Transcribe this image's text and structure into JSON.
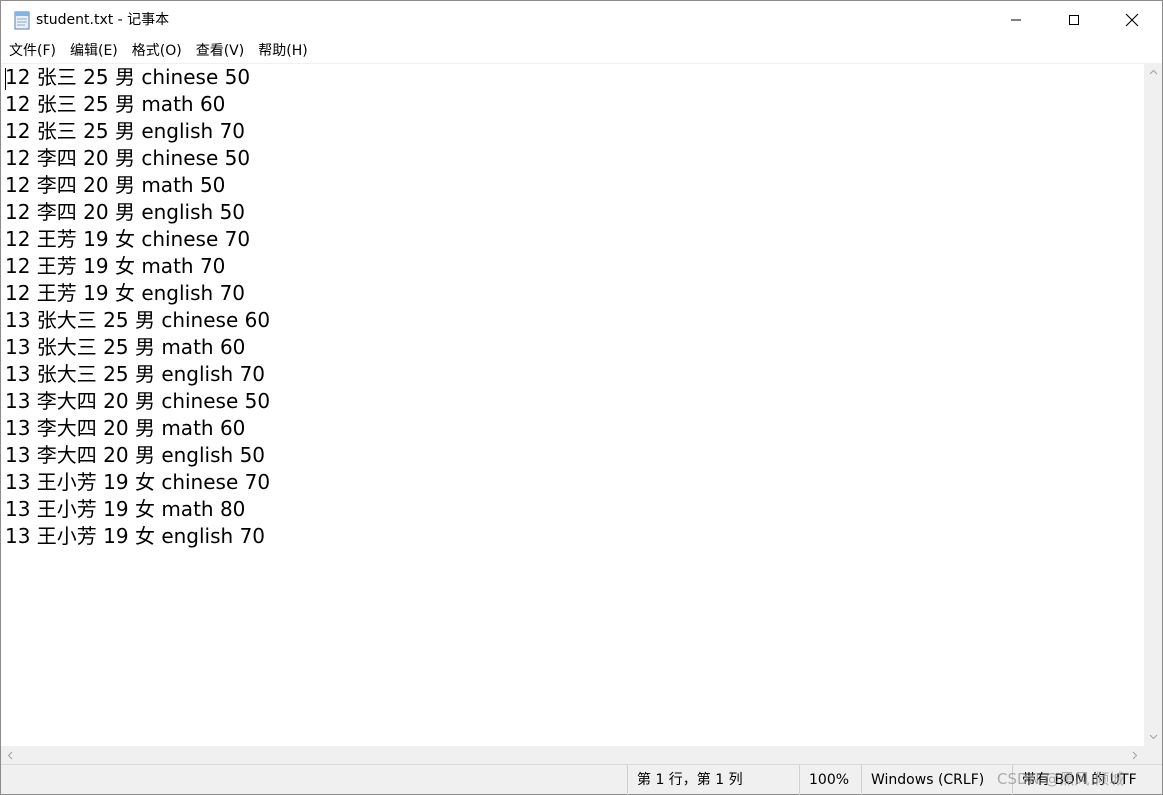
{
  "window": {
    "title": "student.txt - 记事本"
  },
  "menu": [
    {
      "label": "文件(F)"
    },
    {
      "label": "编辑(E)"
    },
    {
      "label": "格式(O)"
    },
    {
      "label": "查看(V)"
    },
    {
      "label": "帮助(H)"
    }
  ],
  "editor": {
    "lines": [
      "12 张三 25 男 chinese 50",
      "12 张三 25 男 math 60",
      "12 张三 25 男 english 70",
      "12 李四 20 男 chinese 50",
      "12 李四 20 男 math 50",
      "12 李四 20 男 english 50",
      "12 王芳 19 女 chinese 70",
      "12 王芳 19 女 math 70",
      "12 王芳 19 女 english 70",
      "13 张大三 25 男 chinese 60",
      "13 张大三 25 男 math 60",
      "13 张大三 25 男 english 70",
      "13 李大四 20 男 chinese 50",
      "13 李大四 20 男 math 60",
      "13 李大四 20 男 english 50",
      "13 王小芳 19 女 chinese 70",
      "13 王小芳 19 女 math 80",
      "13 王小芳 19 女 english 70"
    ]
  },
  "status": {
    "position": "第 1 行，第 1 列",
    "zoom": "100%",
    "line_ending": "Windows (CRLF)",
    "encoding": "带有 BOM 的 UTF"
  },
  "watermark": "CSDN @黑风 倾城",
  "icons": {
    "app": "notepad-icon",
    "minimize": "minimize-icon",
    "maximize": "maximize-icon",
    "close": "close-icon"
  }
}
